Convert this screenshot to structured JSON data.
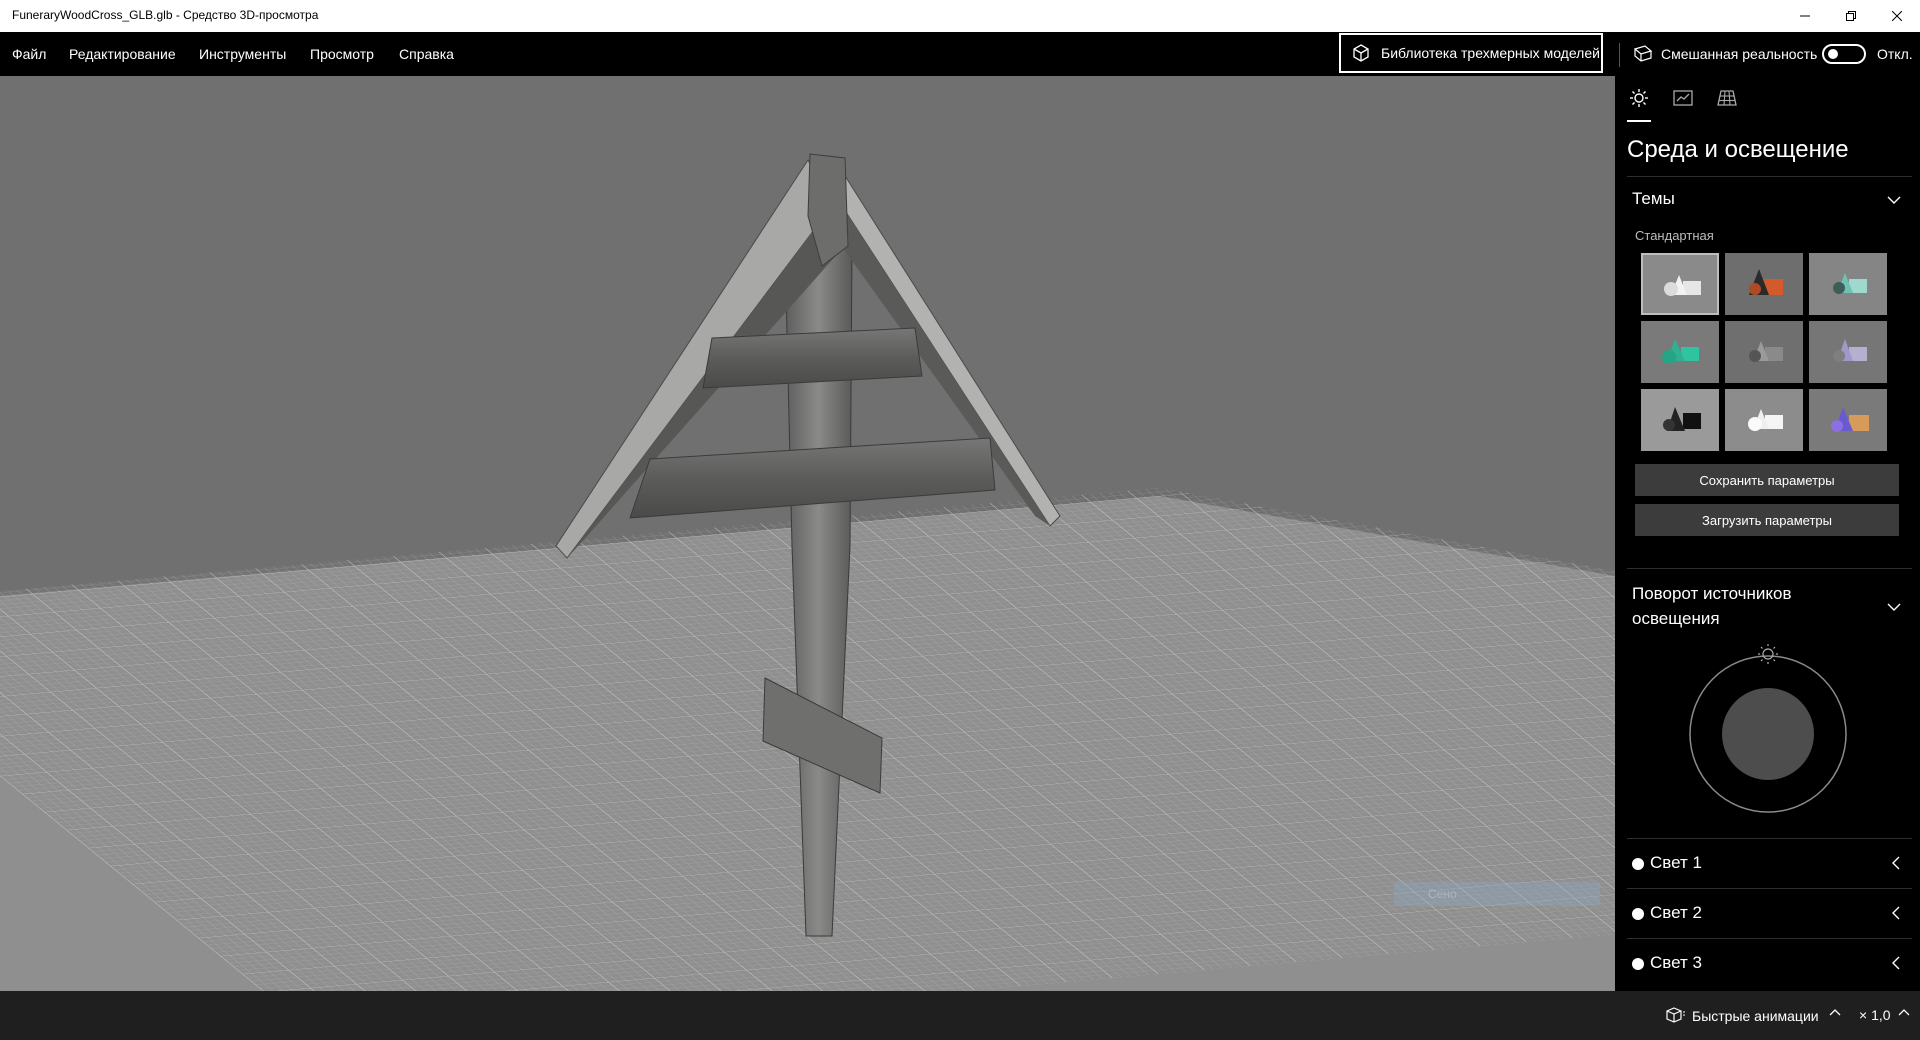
{
  "window": {
    "title": "FuneraryWoodCross_GLB.glb - Средство 3D-просмотра"
  },
  "menu": {
    "items": [
      "Файл",
      "Редактирование",
      "Инструменты",
      "Просмотр",
      "Справка"
    ],
    "library_button": "Библиотека трехмерных моделей",
    "mixed_reality": "Смешанная реальность",
    "toggle_state": "Откл."
  },
  "viewport": {
    "ghost_label": "Сено"
  },
  "panel": {
    "title": "Среда и освещение",
    "themes": {
      "label": "Темы",
      "group_label": "Стандартная",
      "save_button": "Сохранить параметры",
      "load_button": "Загрузить параметры",
      "selected_index": 0
    },
    "rotation": {
      "label_line1": "Поворот источников",
      "label_line2": "освещения"
    },
    "lights": [
      "Свет 1",
      "Свет 2",
      "Свет 3"
    ]
  },
  "status": {
    "animations": "Быстрые анимации",
    "speed": "× 1,0"
  },
  "colors": {
    "accent_dark": "#000000",
    "panel_button": "#3c3c3c",
    "viewport_bg": "#717171"
  }
}
